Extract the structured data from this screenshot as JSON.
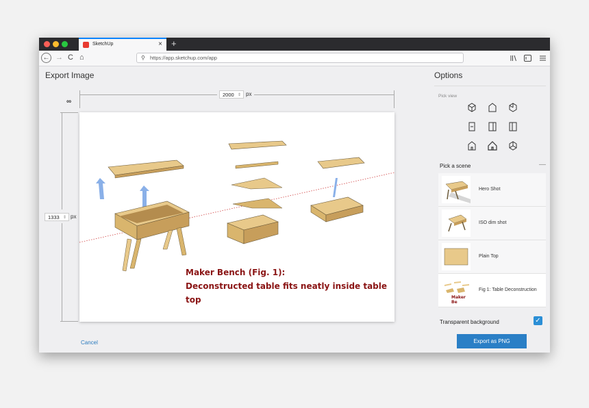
{
  "browser": {
    "tab_title": "SketchUp",
    "tab_close": "×",
    "new_tab": "+",
    "url": "https://app.sketchup.com/app",
    "back": "←",
    "forward": "→",
    "reload": "C",
    "home": "⌂"
  },
  "export": {
    "title": "Export Image",
    "width_value": "2000",
    "height_value": "1333",
    "unit": "px",
    "cancel_label": "Cancel",
    "caption_line1": "Maker Bench (Fig. 1):",
    "caption_line2": "Deconstructed table fits neatly inside table top"
  },
  "options": {
    "title": "Options",
    "pick_view_label": "Pick view",
    "views": [
      "iso-view-icon",
      "top-view-icon",
      "right-iso-view-icon",
      "front-view-icon",
      "left-view-icon",
      "right-view-icon",
      "back-iso-view-icon",
      "home-view-icon",
      "bottom-iso-view-icon"
    ],
    "pick_scene_label": "Pick a scene",
    "collapse": "—",
    "scenes": [
      {
        "name": "Hero Shot"
      },
      {
        "name": "ISO dim shot"
      },
      {
        "name": "Plain Top"
      },
      {
        "name": "Fig 1: Table Deconstruction",
        "thumb_text": "Maker Be"
      }
    ],
    "transparent_label": "Transparent background",
    "transparent_checked": true,
    "check": "✓",
    "export_label": "Export as PNG"
  },
  "colors": {
    "accent": "#2a7fc6",
    "caption": "#8a1414",
    "wood": "#e8c98a"
  }
}
